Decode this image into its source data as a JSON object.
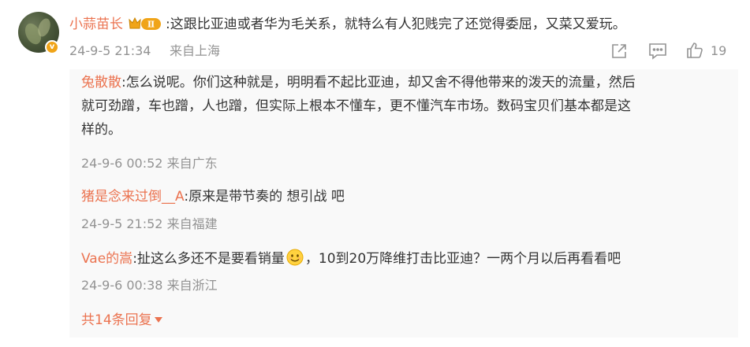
{
  "comment": {
    "username": "小蒜苗长",
    "badge_level": "Ⅱ",
    "verify_mark": "v",
    "text": ":这跟比亚迪或者华为毛关系，就特么有人犯贱完了还觉得委屈，又菜又爱玩。",
    "date": "24-9-5 21:34",
    "location": "来自上海",
    "like_count": "19",
    "icons": [
      "share-icon",
      "comment-icon",
      "like-icon"
    ]
  },
  "replies": [
    {
      "username": "兔散散",
      "text_line1": ":怎么说呢。你们这种就是，明明看不起比亚迪，却又舍不得他带来的泼天的流量，然后",
      "text_line2": "就可劲蹭，车也蹭，人也蹭，但实际上根本不懂车，更不懂汽车市场。数码宝贝们基本都是这",
      "text_line3": "样的。",
      "date": "24-9-6 00:52",
      "location": "来自广东"
    },
    {
      "username": "猪是念来过倒__A",
      "text": ":原来是带节奏的 想引战 吧",
      "date": "24-9-5 21:52",
      "location": "来自福建"
    },
    {
      "username": "Vae的嵩",
      "text_before_emoji": ":扯这么多还不是要看销量",
      "text_after_emoji": "，10到20万降维打击比亚迪？一两个月以后再看看吧",
      "emoji": "smile-emoji",
      "date": "24-9-6 00:38",
      "location": "来自浙江"
    }
  ],
  "more_replies_label": "共14条回复",
  "colors": {
    "username": "#eb7350",
    "text": "#333333",
    "meta": "#939393",
    "reply_bg": "#f9f9f9",
    "badge": "#f0a418"
  }
}
